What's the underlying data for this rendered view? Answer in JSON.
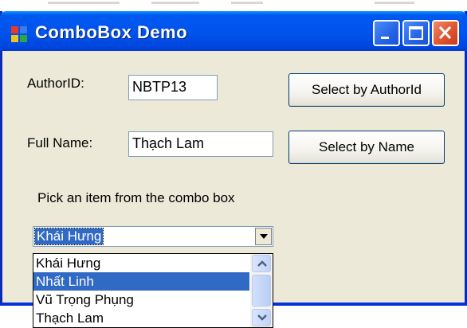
{
  "window": {
    "title": "ComboBox  Demo"
  },
  "form": {
    "author_id_label": "AuthorID:",
    "author_id_value": "NBTP13",
    "full_name_label": "Full Name:",
    "full_name_value": "Thạch Lam",
    "select_by_author_button": "Select by AuthorId",
    "select_by_name_button": "Select by Name",
    "instruction": "Pick an item from the combo box"
  },
  "combo": {
    "selected_value": "Khái Hưng",
    "items": [
      "Khái Hưng",
      "Nhất Linh",
      "Vũ Trọng Phụng",
      "Thạch Lam"
    ],
    "highlighted_item": "Nhất Linh"
  },
  "colors": {
    "titlebar": "#0053ee",
    "selection": "#316ac5",
    "window_face": "#ece9d8",
    "close_button": "#e0552f"
  },
  "icons": [
    "app-icon",
    "minimize-icon",
    "maximize-icon",
    "close-icon",
    "dropdown-arrow-icon",
    "scroll-up-icon",
    "scroll-down-icon"
  ]
}
